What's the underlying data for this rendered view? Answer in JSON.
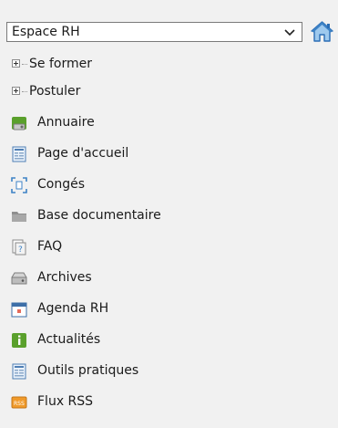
{
  "space": {
    "selected": "Espace RH"
  },
  "tree": [
    {
      "label": "Se former"
    },
    {
      "label": "Postuler"
    }
  ],
  "items": [
    {
      "label": "Annuaire",
      "icon": "directory-icon"
    },
    {
      "label": "Page d'accueil",
      "icon": "home-page-icon"
    },
    {
      "label": "Congés",
      "icon": "leave-icon"
    },
    {
      "label": "Base documentaire",
      "icon": "folder-icon"
    },
    {
      "label": "FAQ",
      "icon": "faq-icon"
    },
    {
      "label": "Archives",
      "icon": "archive-icon"
    },
    {
      "label": "Agenda RH",
      "icon": "calendar-icon"
    },
    {
      "label": "Actualités",
      "icon": "news-icon"
    },
    {
      "label": "Outils pratiques",
      "icon": "tools-icon"
    },
    {
      "label": "Flux RSS",
      "icon": "rss-icon"
    }
  ],
  "colors": {
    "accent": "#2a6db5",
    "home_roof": "#3d82c6",
    "news_green": "#5aa02c",
    "rss_orange": "#f09a2a"
  }
}
